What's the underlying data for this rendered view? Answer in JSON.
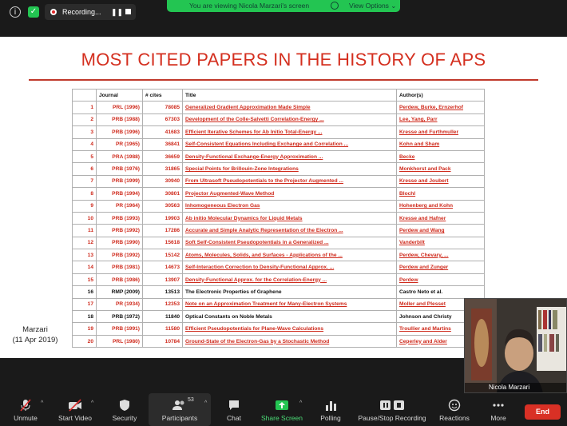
{
  "zoom_top": {
    "recording_label": "Recording...",
    "viewing_banner": "You are viewing Nicola Marzari's screen",
    "view_options": "View Options"
  },
  "slide": {
    "title": "MOST CITED PAPERS IN THE HISTORY OF APS",
    "headers": [
      "",
      "Journal",
      "# cites",
      "Title",
      "Author(s)"
    ],
    "rows": [
      {
        "n": "1",
        "journal": "PRL (1996)",
        "cites": "78085",
        "title": "Generalized Gradient Approximation Made Simple",
        "authors": "Perdew, Burke, Ernzerhof",
        "color": "red"
      },
      {
        "n": "2",
        "journal": "PRB (1988)",
        "cites": "67303",
        "title": "Development of the Colle-Salvetti Correlation-Energy ...",
        "authors": "Lee, Yang, Parr",
        "color": "red"
      },
      {
        "n": "3",
        "journal": "PRB (1996)",
        "cites": "41683",
        "title": "Efficient Iterative Schemes for Ab Initio Total-Energy ...",
        "authors": "Kresse and Furthmuller",
        "color": "red"
      },
      {
        "n": "4",
        "journal": "PR (1965)",
        "cites": "36841",
        "title": "Self-Consistent Equations Including Exchange and Correlation ...",
        "authors": "Kohn and Sham",
        "color": "red"
      },
      {
        "n": "5",
        "journal": "PRA (1988)",
        "cites": "36659",
        "title": "Density-Functional Exchange-Energy Approximation ...",
        "authors": "Becke",
        "color": "red"
      },
      {
        "n": "6",
        "journal": "PRB (1976)",
        "cites": "31865",
        "title": "Special Points for Brillouin-Zone Integrations",
        "authors": "Monkhorst and Pack",
        "color": "red"
      },
      {
        "n": "7",
        "journal": "PRB (1999)",
        "cites": "30940",
        "title": "From Ultrasoft Pseudopotentials to the Projector Augmented ...",
        "authors": "Kresse and Joubert",
        "color": "red"
      },
      {
        "n": "8",
        "journal": "PRB (1994)",
        "cites": "30801",
        "title": "Projector Augmented-Wave Method",
        "authors": "Blochl",
        "color": "red"
      },
      {
        "n": "9",
        "journal": "PR (1964)",
        "cites": "30563",
        "title": "Inhomogeneous Electron Gas",
        "authors": "Hohenberg and Kohn",
        "color": "red"
      },
      {
        "n": "10",
        "journal": "PRB (1993)",
        "cites": "19903",
        "title": "Ab initio Molecular Dynamics for Liquid Metals",
        "authors": "Kresse and Hafner",
        "color": "red"
      },
      {
        "n": "11",
        "journal": "PRB (1992)",
        "cites": "17286",
        "title": "Accurate and Simple Analytic Representation of the Electron ...",
        "authors": "Perdew and Wang",
        "color": "red"
      },
      {
        "n": "12",
        "journal": "PRB (1990)",
        "cites": "15618",
        "title": "Soft Self-Consistent Pseudopotentials in a Generalized ...",
        "authors": "Vanderbilt",
        "color": "red"
      },
      {
        "n": "13",
        "journal": "PRB (1992)",
        "cites": "15142",
        "title": "Atoms, Molecules, Solids, and Surfaces - Applications of the ...",
        "authors": "Perdew, Chevary, ...",
        "color": "red"
      },
      {
        "n": "14",
        "journal": "PRB (1981)",
        "cites": "14673",
        "title": "Self-Interaction Correction to Density-Functional Approx. ...",
        "authors": "Perdew and Zunger",
        "color": "red"
      },
      {
        "n": "15",
        "journal": "PRB (1986)",
        "cites": "13907",
        "title": "Density-Functional Approx. for the Correlation-Energy ...",
        "authors": "Perdew",
        "color": "red"
      },
      {
        "n": "16",
        "journal": "RMP (2009)",
        "cites": "13513",
        "title": "The Electronic Properties of Graphene",
        "authors": "Castro Neto et al.",
        "color": "black"
      },
      {
        "n": "17",
        "journal": "PR (1934)",
        "cites": "12353",
        "title": "Note on an Approximation Treatment for Many-Electron Systems",
        "authors": "Moller and Plesset",
        "color": "red"
      },
      {
        "n": "18",
        "journal": "PRB (1972)",
        "cites": "11840",
        "title": "Optical Constants on Noble Metals",
        "authors": "Johnson and Christy",
        "color": "black"
      },
      {
        "n": "19",
        "journal": "PRB (1991)",
        "cites": "11580",
        "title": "Efficient Pseudopotentials for Plane-Wave Calculations",
        "authors": "Troullier and Martins",
        "color": "red"
      },
      {
        "n": "20",
        "journal": "PRL (1980)",
        "cites": "10784",
        "title": "Ground-State of the Electron-Gas by a Stochastic Method",
        "authors": "Ceperley and Alder",
        "color": "red"
      }
    ],
    "credit_name": "Marzari",
    "credit_date": "(11 Apr 2019)"
  },
  "video": {
    "participant_name": "Nicola Marzari"
  },
  "toolbar": {
    "unmute": "Unmute",
    "start_video": "Start Video",
    "security": "Security",
    "participants": "Participants",
    "participants_count": "53",
    "chat": "Chat",
    "share_screen": "Share Screen",
    "polling": "Polling",
    "pause_recording": "Pause/Stop Recording",
    "reactions": "Reactions",
    "more": "More",
    "end": "End"
  },
  "colors": {
    "accent_red": "#d42f1f",
    "share_green": "#23c552",
    "end_red": "#d93025"
  }
}
